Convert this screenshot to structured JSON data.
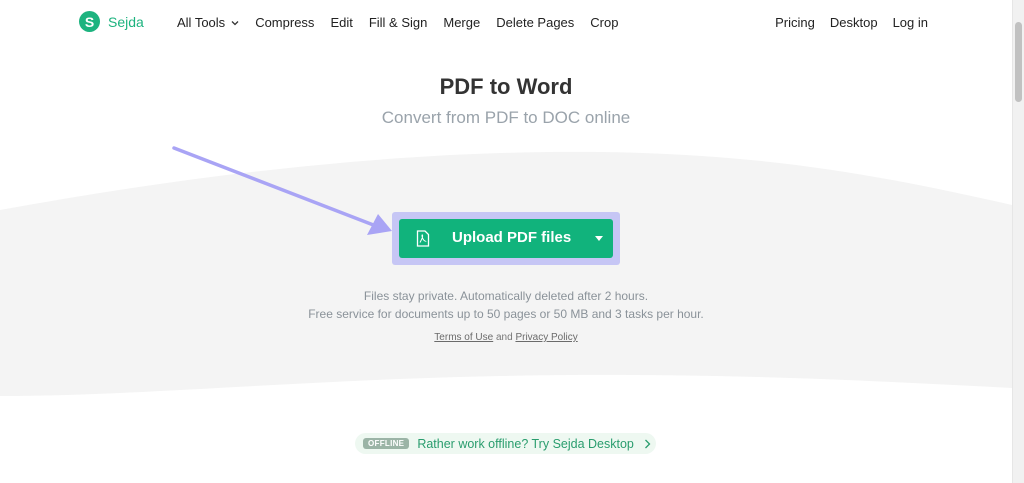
{
  "nav": {
    "logo_text": "Sejda",
    "logo_letter": "S",
    "left_items": [
      "Compress",
      "Edit",
      "Fill & Sign",
      "Merge",
      "Delete Pages",
      "Crop"
    ],
    "all_tools_label": "All Tools",
    "right_items": [
      "Pricing",
      "Desktop",
      "Log in"
    ]
  },
  "hero": {
    "title": "PDF to Word",
    "subtitle": "Convert from PDF to DOC online"
  },
  "upload": {
    "label": "Upload PDF files",
    "button_color": "#11b37c",
    "highlight_color": "#c6c6f5"
  },
  "info": {
    "privacy_note": "Files stay private. Automatically deleted after 2 hours.",
    "limits_note": "Free service for documents up to 50 pages or 50 MB and 3 tasks per hour.",
    "terms_link": "Terms of Use",
    "and_text": "and",
    "privacy_link": "Privacy Policy"
  },
  "offline": {
    "badge": "OFFLINE",
    "text": "Rather work offline? Try Sejda Desktop"
  },
  "colors": {
    "brand": "#1db37f",
    "arrow": "#a9a4f5"
  }
}
